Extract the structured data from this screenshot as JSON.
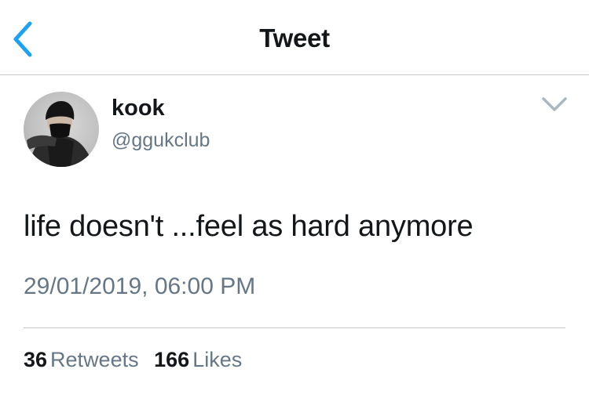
{
  "nav": {
    "title": "Tweet",
    "back_icon": "chevron-left-icon",
    "accent_color": "#1da1f2"
  },
  "tweet": {
    "author": {
      "name": "kook",
      "handle": "@ggukclub"
    },
    "text": "life doesn't ...feel as hard anymore",
    "timestamp": "29/01/2019, 06:00 PM",
    "menu_icon": "chevron-down-icon",
    "stats": {
      "retweets_count": "36",
      "retweets_label": "Retweets",
      "likes_count": "166",
      "likes_label": "Likes"
    }
  },
  "colors": {
    "text_primary": "#14171a",
    "text_secondary": "#657786",
    "divider": "#c8c8cc"
  }
}
